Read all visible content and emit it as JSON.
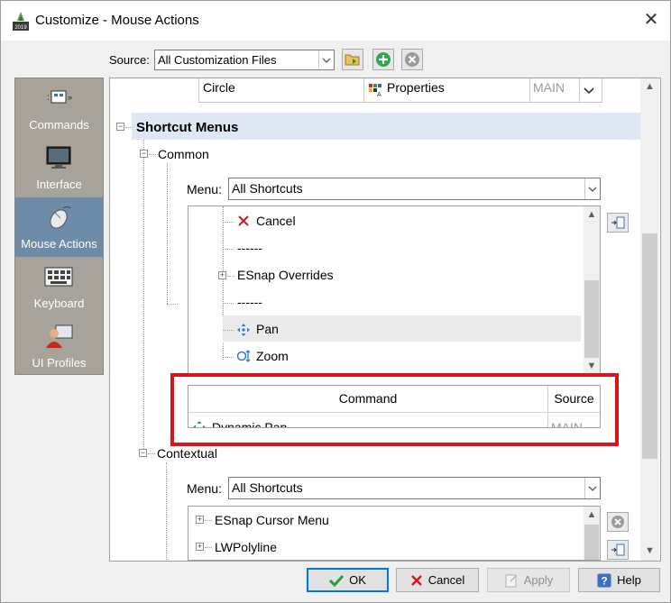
{
  "window": {
    "title": "Customize - Mouse Actions",
    "close_label": "✕"
  },
  "source": {
    "label": "Source:",
    "value": "All Customization Files"
  },
  "sidebar": {
    "items": [
      {
        "label": "Commands",
        "icon": "commands-icon"
      },
      {
        "label": "Interface",
        "icon": "monitor-icon"
      },
      {
        "label": "Mouse Actions",
        "icon": "mouse-icon"
      },
      {
        "label": "Keyboard",
        "icon": "keyboard-icon"
      },
      {
        "label": "UI Profiles",
        "icon": "user-profile-icon"
      }
    ]
  },
  "top_row": {
    "name": "Circle",
    "action": "Properties",
    "source": "MAIN"
  },
  "shortcut_menus": {
    "title": "Shortcut Menus",
    "common": {
      "label": "Common",
      "menu_label": "Menu:",
      "menu_value": "All Shortcuts",
      "items": [
        "Cancel",
        "------",
        "ESnap Overrides",
        "------",
        "Pan",
        "Zoom"
      ]
    },
    "command_table": {
      "headers": [
        "Command",
        "Source"
      ],
      "rows": [
        {
          "command": "Dynamic Pan",
          "source": "MAIN"
        }
      ]
    },
    "contextual": {
      "label": "Contextual",
      "menu_label": "Menu:",
      "menu_value": "All Shortcuts",
      "items": [
        "ESnap Cursor Menu",
        "LWPolyline"
      ]
    }
  },
  "buttons": {
    "ok": "OK",
    "cancel": "Cancel",
    "apply": "Apply",
    "help": "Help"
  },
  "colors": {
    "highlight_box": "#d8141c",
    "sidebar_bg": "#a7a29a",
    "sidebar_active": "#6e8ba8",
    "section_bar": "#dfe7f5"
  }
}
